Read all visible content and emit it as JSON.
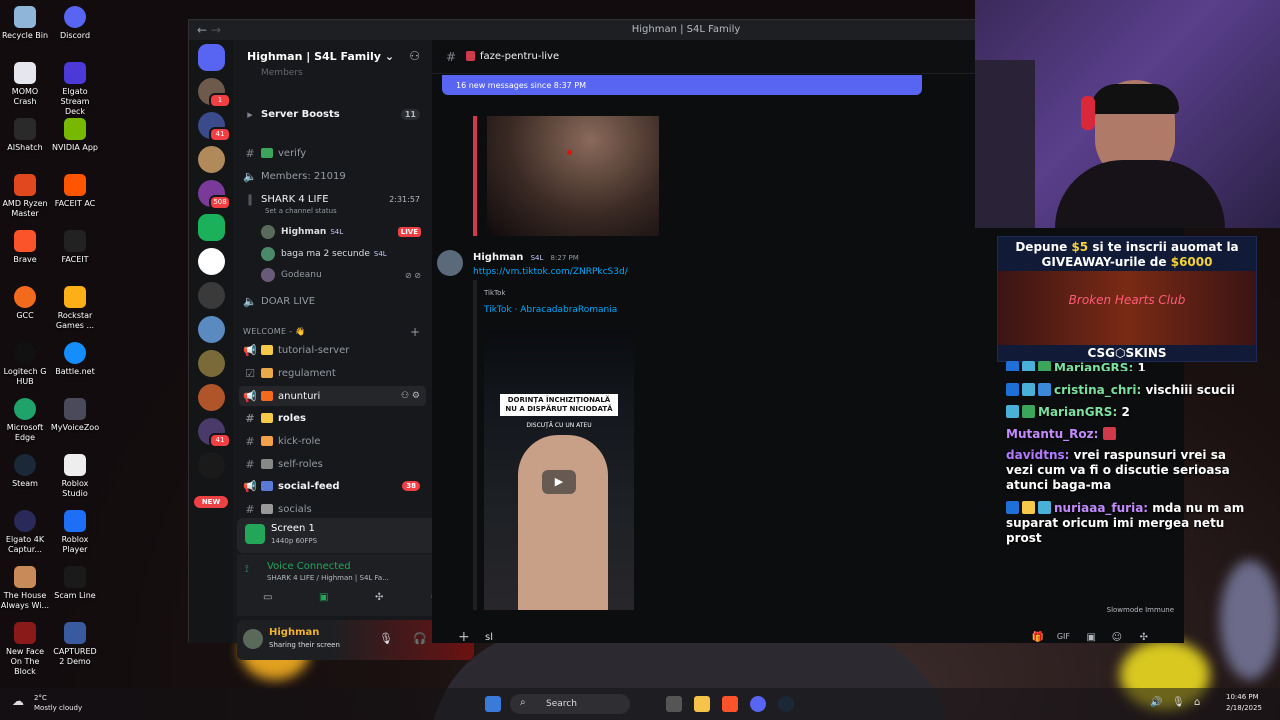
{
  "desktop": {
    "icons": [
      {
        "label": "Recycle Bin"
      },
      {
        "label": "Discord"
      },
      {
        "label": "MOMO Crash"
      },
      {
        "label": "Elgato Stream Deck"
      },
      {
        "label": "AIShatch"
      },
      {
        "label": "NVIDIA App"
      },
      {
        "label": "AMD Ryzen Master"
      },
      {
        "label": "FACEIT AC"
      },
      {
        "label": "Brave"
      },
      {
        "label": "FACEIT"
      },
      {
        "label": "GCC"
      },
      {
        "label": "Rockstar Games ..."
      },
      {
        "label": "Logitech G HUB"
      },
      {
        "label": "Battle.net"
      },
      {
        "label": "Microsoft Edge"
      },
      {
        "label": "MyVoiceZoo"
      },
      {
        "label": "Steam"
      },
      {
        "label": "Roblox Studio"
      },
      {
        "label": "Elgato 4K Captur..."
      },
      {
        "label": "Roblox Player"
      },
      {
        "label": "The House Always Wi..."
      },
      {
        "label": "Scam Line"
      },
      {
        "label": "New Face On The Block"
      },
      {
        "label": "CAPTURED 2 Demo"
      }
    ]
  },
  "window": {
    "title": "Highman | S4L Family",
    "nav_back": "←",
    "nav_fwd": "→"
  },
  "guilds": {
    "badges": [
      "1",
      "41",
      "508",
      "41"
    ],
    "new_label": "NEW"
  },
  "server": {
    "name": "Highman | S4L Family",
    "chevron": "⌄",
    "members_cut": "Members",
    "boosts_label": "Server Boosts",
    "boosts_count": "11",
    "channels": [
      {
        "name": "verify"
      },
      {
        "name": "Members: 21019"
      },
      {
        "name": "SHARK 4 LIFE",
        "timer": "2:31:57",
        "status": "Set a channel status"
      },
      {
        "name": "DOAR LIVE"
      }
    ],
    "voice_users": [
      {
        "name": "Highman",
        "tag": "S4L",
        "live": "LIVE"
      },
      {
        "name": "baga ma 2 secunde",
        "tag": "S4L"
      },
      {
        "name": "Godeanu"
      }
    ],
    "category": "WELCOME - 👋",
    "category_channels": [
      {
        "name": "tutorial-server"
      },
      {
        "name": "regulament"
      },
      {
        "name": "anunturi"
      },
      {
        "name": "roles"
      },
      {
        "name": "kick-role"
      },
      {
        "name": "self-roles"
      },
      {
        "name": "social-feed",
        "count": "38"
      },
      {
        "name": "socials"
      }
    ]
  },
  "screen_share": {
    "title": "Screen 1",
    "quality": "1440p 60FPS"
  },
  "voice": {
    "status": "Voice Connected",
    "channel": "SHARK 4 LIFE / Highman | S4L Fa..."
  },
  "user": {
    "name": "Highman",
    "status": "Sharing their screen"
  },
  "channel": {
    "name": "faze-pentru-live",
    "new_messages": "16 new messages since 8:37 PM"
  },
  "message": {
    "author": "Highman",
    "tag": "S4L",
    "time": "8:27 PM",
    "link": "https://vm.tiktok.com/ZNRPkcS3d/",
    "embed_provider": "TikTok",
    "embed_title": "TikTok · AbracadabraRomania",
    "video_caption": "DORINȚA ÎNCHIZIȚIONALĂ NU A DISPĂRUT NICIODATĂ",
    "video_sub": "DISCUȚĂ CU UN ATEU"
  },
  "composer": {
    "text": "sl",
    "slowmode": "Slowmode Immune"
  },
  "overlay": {
    "ad_line1_a": "Depune ",
    "ad_line1_b": "$5",
    "ad_line1_c": " si te inscrii auomat la",
    "ad_line2_a": "GIVEAWAY-urile de ",
    "ad_line2_b": "$6000",
    "ad_image_text": "Broken Hearts Club",
    "ad_brand": "CSG⬡SKINS",
    "chat": [
      {
        "user": "MarianGRS:",
        "text": "1",
        "color": "#7be0a0"
      },
      {
        "user": "cristina_chri:",
        "text": "vischiii scucii",
        "color": "#7be0a0"
      },
      {
        "user": "MarianGRS:",
        "text": "2",
        "color": "#7be0a0"
      },
      {
        "user": "Mutantu_Roz:",
        "text": "",
        "color": "#c38bff"
      },
      {
        "user": "davidtns:",
        "text": "vrei raspunsuri vrei sa vezi cum va fi o discutie serioasa atunci baga-ma",
        "color": "#b37bff"
      },
      {
        "user": "nuriaaa_furia:",
        "text": "mda nu m am suparat oricum imi mergea netu prost",
        "color": "#c38bff"
      }
    ]
  },
  "taskbar": {
    "weather_temp": "2°C",
    "weather_desc": "Mostly cloudy",
    "search": "Search",
    "time": "10:46 PM",
    "date": "2/18/2025"
  },
  "colors": {
    "accent": "#5865f2",
    "live": "#ed4245",
    "bg": "#0c0d0e"
  }
}
